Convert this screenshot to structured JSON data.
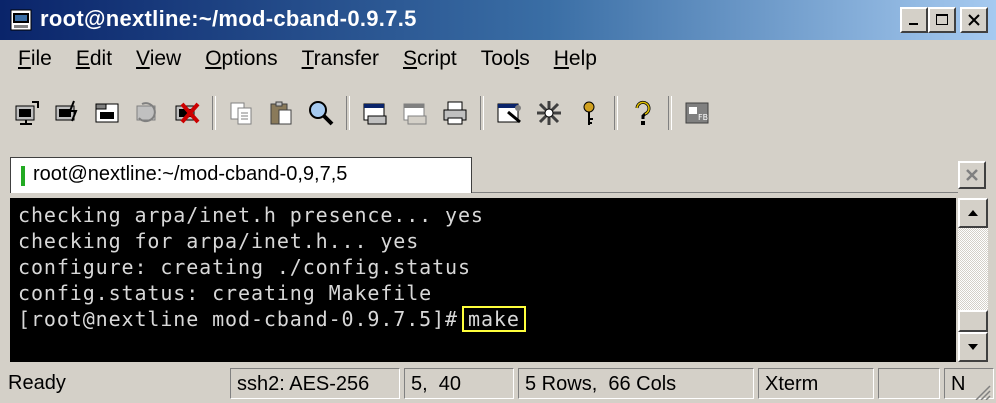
{
  "window": {
    "title": "root@nextline:~/mod-cband-0.9.7.5",
    "icon": "securecrt-app-icon",
    "controls": [
      "minimize-icon",
      "maximize-icon",
      "close-icon"
    ]
  },
  "menu": [
    {
      "pre": "",
      "u": "F",
      "post": "ile"
    },
    {
      "pre": "",
      "u": "E",
      "post": "dit"
    },
    {
      "pre": "",
      "u": "V",
      "post": "iew"
    },
    {
      "pre": "",
      "u": "O",
      "post": "ptions"
    },
    {
      "pre": "",
      "u": "T",
      "post": "ransfer"
    },
    {
      "pre": "",
      "u": "S",
      "post": "cript"
    },
    {
      "pre": "Too",
      "u": "l",
      "post": "s"
    },
    {
      "pre": "",
      "u": "H",
      "post": "elp"
    }
  ],
  "toolbar_icons": [
    "connect-icon",
    "quick-connect-icon",
    "connect-tab-icon",
    "reconnect-icon",
    "disconnect-icon",
    "copy-icon",
    "paste-icon",
    "find-icon",
    "print-icon",
    "print-selection-icon",
    "printer-icon",
    "session-options-icon",
    "global-options-icon",
    "key-icon",
    "help-icon",
    "sftp-icon"
  ],
  "tab": {
    "label": "root@nextline:~/mod-cband-0,9,7,5",
    "indicator_color": "#22aa22"
  },
  "terminal": {
    "lines": [
      "checking arpa/inet.h presence... yes",
      "checking for arpa/inet.h... yes",
      "configure: creating ./config.status",
      "config.status: creating Makefile"
    ],
    "prompt": "[root@nextline mod-cband-0.9.7.5]#",
    "command": "make",
    "highlight_color": "#ffff3c"
  },
  "status": {
    "ready": "Ready",
    "cipher": "ssh2: AES-256",
    "cursor": "5,  40",
    "size": "5 Rows,  66 Cols",
    "emulation": "Xterm",
    "num": "",
    "mode": "N"
  }
}
